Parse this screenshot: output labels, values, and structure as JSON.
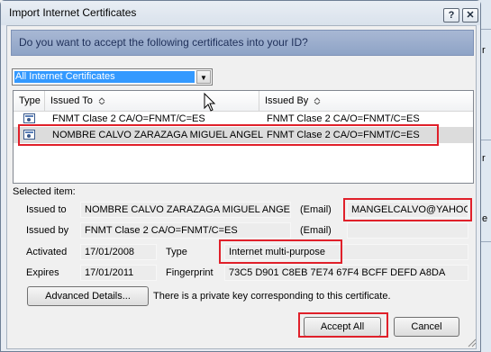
{
  "window": {
    "title": "Import Internet Certificates",
    "help_glyph": "?",
    "close_glyph": "✕"
  },
  "banner": "Do you want to accept the following certificates into your ID?",
  "filter": {
    "selected": "All Internet Certificates",
    "arrow": "▼"
  },
  "list": {
    "headers": {
      "type": "Type",
      "issued_to": "Issued To",
      "issued_by": "Issued By"
    },
    "rows": [
      {
        "issued_to": "FNMT Clase 2 CA/O=FNMT/C=ES",
        "issued_by": "FNMT Clase 2 CA/O=FNMT/C=ES"
      },
      {
        "issued_to": "NOMBRE CALVO ZARAZAGA MIGUEL ANGEL",
        "issued_by": "FNMT Clase 2 CA/O=FNMT/C=ES"
      }
    ]
  },
  "details": {
    "section_label": "Selected item:",
    "issued_to_label": "Issued to",
    "issued_to_value": "NOMBRE CALVO ZARAZAGA MIGUEL ANGEL",
    "email_label": "(Email)",
    "issued_to_email": "MANGELCALVO@YAHOO",
    "issued_by_label": "Issued by",
    "issued_by_value": "FNMT Clase 2 CA/O=FNMT/C=ES",
    "issued_by_email_label": "(Email)",
    "activated_label": "Activated",
    "activated_value": "17/01/2008",
    "type_label": "Type",
    "type_value": "Internet multi-purpose",
    "expires_label": "Expires",
    "expires_value": "17/01/2011",
    "fingerprint_label": "Fingerprint",
    "fingerprint_value": "73C5 D901 C8EB 7E74 67F4 BCFF DEFD A8DA"
  },
  "advanced_button": "Advanced Details...",
  "private_key_note": "There is a private key corresponding to this certificate.",
  "accept_button": "Accept All",
  "cancel_button": "Cancel",
  "background_window": {
    "letter_1": "r",
    "letter_2": "r",
    "letter_3": "e"
  },
  "colors": {
    "banner": "#9cafcf",
    "selection": "#3399ff",
    "highlight_box": "#e0202a"
  }
}
